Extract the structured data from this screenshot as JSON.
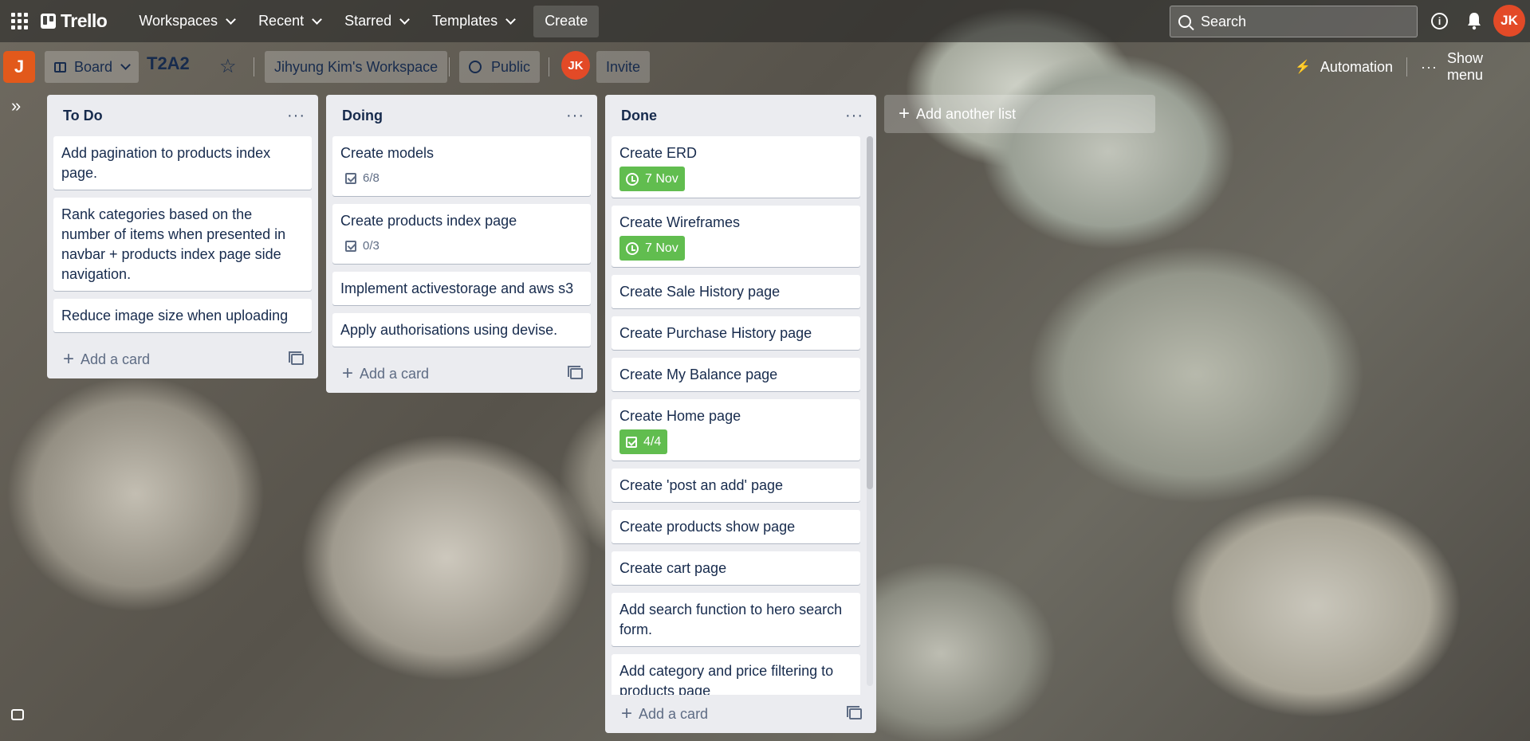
{
  "topbar": {
    "brand": "Trello",
    "nav": [
      "Workspaces",
      "Recent",
      "Starred",
      "Templates"
    ],
    "create": "Create",
    "search_placeholder": "Search",
    "avatar_initials": "JK"
  },
  "board": {
    "workspace_badge": "J",
    "view": "Board",
    "title": "T2A2",
    "workspace": "Jihyung Kim's Workspace",
    "visibility": "Public",
    "member_initials": "JK",
    "invite": "Invite",
    "automation": "Automation",
    "show_menu": "Show menu"
  },
  "lists": [
    {
      "title": "To Do",
      "cards": [
        {
          "title": "Add pagination to products index page."
        },
        {
          "title": "Rank categories based on the number of items when presented in navbar + products index page side navigation."
        },
        {
          "title": "Reduce image size when uploading"
        }
      ],
      "add_card": "Add a card"
    },
    {
      "title": "Doing",
      "cards": [
        {
          "title": "Create models",
          "checklist": "6/8"
        },
        {
          "title": "Create products index page",
          "checklist": "0/3"
        },
        {
          "title": "Implement activestorage and aws s3"
        },
        {
          "title": "Apply authorisations using devise."
        }
      ],
      "add_card": "Add a card"
    },
    {
      "title": "Done",
      "cards": [
        {
          "title": "Create ERD",
          "due": "7 Nov"
        },
        {
          "title": "Create Wireframes",
          "due": "7 Nov"
        },
        {
          "title": "Create Sale History page"
        },
        {
          "title": "Create Purchase History page"
        },
        {
          "title": "Create My Balance page"
        },
        {
          "title": "Create Home page",
          "checklist_done": "4/4"
        },
        {
          "title": "Create 'post an add' page"
        },
        {
          "title": "Create products show page"
        },
        {
          "title": "Create cart page"
        },
        {
          "title": "Add search function to hero search form."
        },
        {
          "title": "Add category and price filtering to products page"
        }
      ],
      "add_card": "Add a card"
    }
  ],
  "add_list": "Add another list",
  "colors": {
    "avatar": "#e34a27",
    "workspace_badge": "#e2591b",
    "due_badge": "#61bd4f"
  }
}
